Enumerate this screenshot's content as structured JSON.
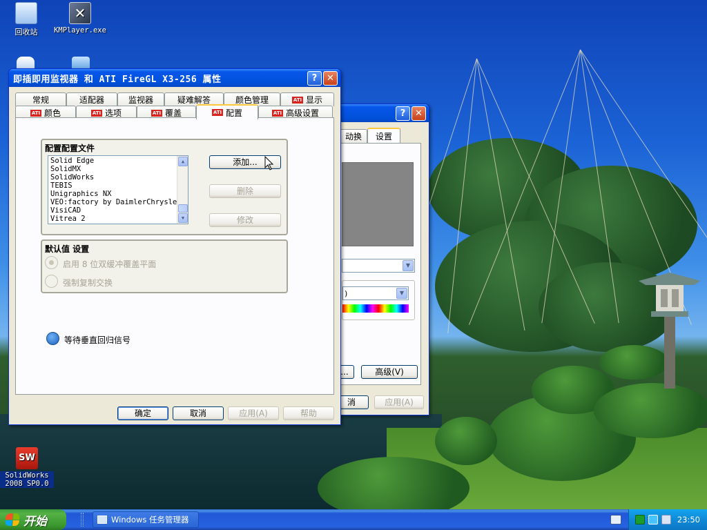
{
  "desktop": {
    "icons": [
      {
        "label": "回收站",
        "icon": "recycle-bin-icon"
      },
      {
        "label": "KMPlayer.exe",
        "icon": "kmplayer-icon"
      },
      {
        "label": "SolidWorks\n2008 SP0.0",
        "icon": "solidworks-icon"
      }
    ]
  },
  "main_dialog": {
    "title": "即插即用监视器 和 ATI FireGL X3-256 属性",
    "help_btn": "?",
    "close_btn": "✕",
    "tabs_row1": [
      "常规",
      "适配器",
      "监视器",
      "疑难解答",
      "颜色管理",
      "显示"
    ],
    "tabs_row2": [
      "颜色",
      "选项",
      "覆盖",
      "配置",
      "高级设置"
    ],
    "active_tab": "配置",
    "profile_group": {
      "title": "配置配置文件",
      "items": [
        "Solid Edge",
        "SolidMX",
        "SolidWorks",
        "TEBIS",
        "Unigraphics NX",
        "VEO:factory by DaimlerChrysler",
        "VisiCAD",
        "Vitrea 2"
      ],
      "add_btn": "添加...",
      "delete_btn": "删除",
      "modify_btn": "修改"
    },
    "defaults_group": {
      "title": "默认值 设置",
      "option1": "启用 8 位双缓冲覆盖平面",
      "option2": "强制复制交换"
    },
    "vsync_label": "等待垂直回归信号",
    "ok_btn": "确定",
    "cancel_btn": "取消",
    "apply_btn": "应用(A)",
    "help_btn_bottom": "帮助"
  },
  "back_dialog": {
    "help_btn": "?",
    "close_btn": "✕",
    "tab_partial": "动换",
    "tab_active": "设置",
    "combo_partial": ")",
    "advanced_btn": "高级(V)",
    "ellipsis_btn": "...",
    "cancel_partial": "消",
    "apply_btn": "应用(A)"
  },
  "taskbar": {
    "start_label": "开始",
    "task_label": "Windows 任务管理器",
    "clock": "23:50"
  }
}
